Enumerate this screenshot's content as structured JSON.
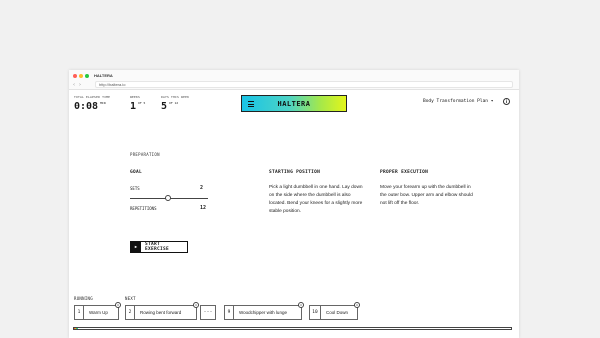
{
  "browser": {
    "tab_title": "HALTERA",
    "url": "http://haltera.io",
    "dot_colors": [
      "#ff5f57",
      "#febc2e",
      "#28c840"
    ]
  },
  "stats": {
    "elapsed": {
      "label": "TOTAL ELAPSED TIME",
      "value": "0:08",
      "suffix": "MIN"
    },
    "weeks": {
      "label": "WEEKS",
      "value": "1",
      "suffix": "OF 5"
    },
    "days": {
      "label": "DAYS THIS WEEK",
      "value": "5",
      "suffix": "OF 12"
    }
  },
  "logo": {
    "text": "HALTERA",
    "gradient": [
      "#19c4e6",
      "#e3f51a"
    ]
  },
  "plan": {
    "label": "Body Transformation Plan ▾"
  },
  "preparation": {
    "label": "PREPARATION",
    "goal_title": "GOAL",
    "sets_label": "SETS",
    "sets_value": "2",
    "reps_label": "REPETITIONS",
    "reps_value": "12"
  },
  "starting_position": {
    "title": "STARTING POSITION",
    "text": "Pick a light dumbbell in one hand. Lay down on the side where the dumbbell is also located. Bend your knees for a slightly more stable position."
  },
  "proper_execution": {
    "title": "PROPER EXECUTION",
    "text": "Move your forearm up with the dumbbell in the outer bow. Upper arm and elbow should not lift off the floor."
  },
  "start_button": {
    "label": "START EXERCISE",
    "icon": "play-icon"
  },
  "queue": {
    "running_label": "RUNNING",
    "next_label": "NEXT",
    "running": {
      "num": "1",
      "label": "Warm Up"
    },
    "next": [
      {
        "num": "2",
        "label": "Rowing bent forward"
      },
      {
        "num": "9",
        "label": "Woodchipper with lunge"
      },
      {
        "num": "10",
        "label": "Cool Down"
      }
    ],
    "ellipsis": "..."
  },
  "progress": {
    "fraction": 0.01
  }
}
